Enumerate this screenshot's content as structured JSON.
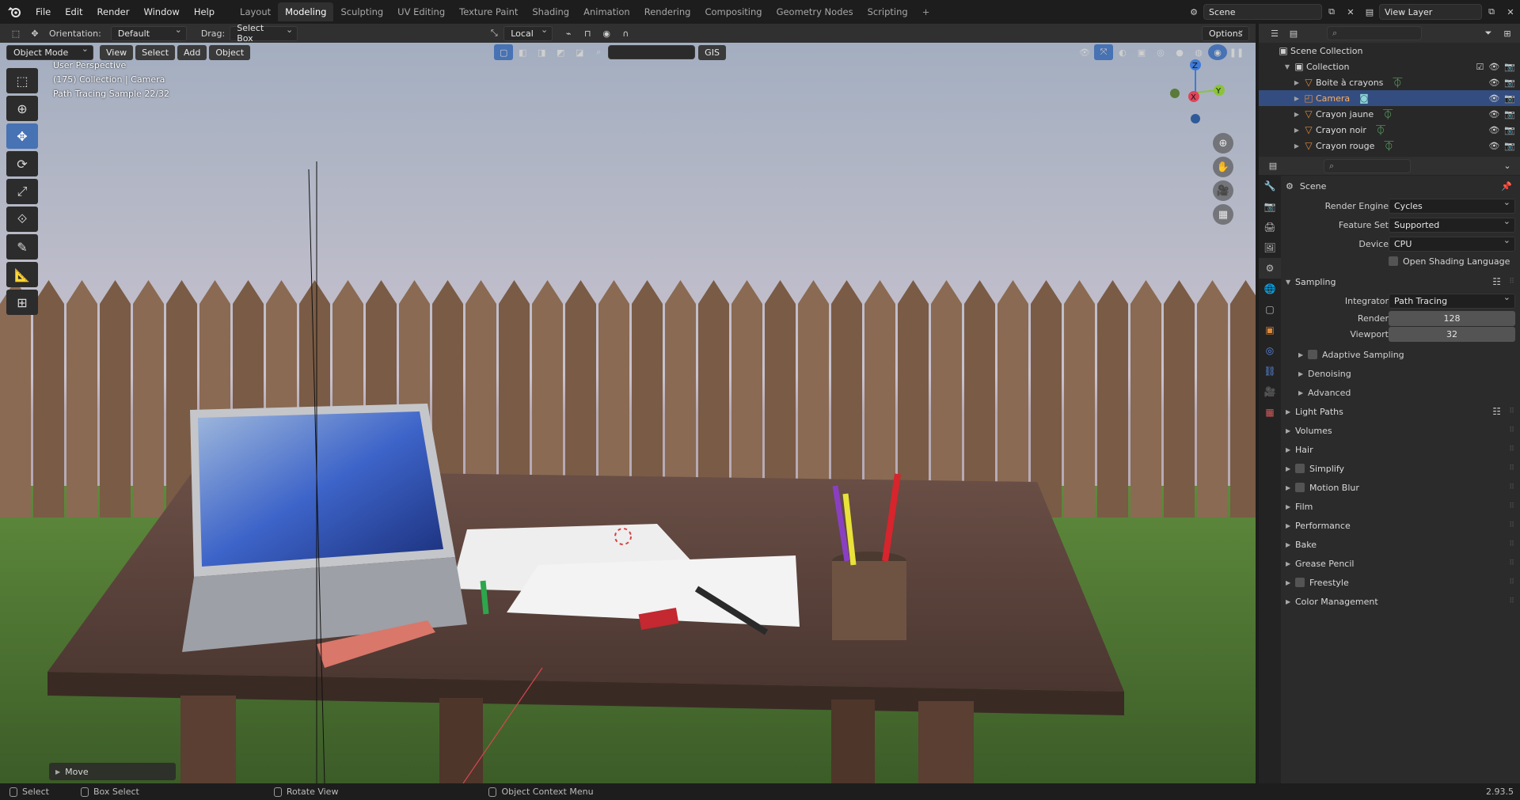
{
  "menu": [
    "File",
    "Edit",
    "Render",
    "Window",
    "Help"
  ],
  "workspace_tabs": [
    "Layout",
    "Modeling",
    "Sculpting",
    "UV Editing",
    "Texture Paint",
    "Shading",
    "Animation",
    "Rendering",
    "Compositing",
    "Geometry Nodes",
    "Scripting"
  ],
  "active_tab": "Modeling",
  "scene_name": "Scene",
  "view_layer": "View Layer",
  "header": {
    "orientation_label": "Orientation:",
    "orientation_value": "Default",
    "drag_label": "Drag:",
    "drag_value": "Select Box",
    "pivot_value": "Local",
    "options_label": "Options"
  },
  "viewport": {
    "mode": "Object Mode",
    "menu": [
      "View",
      "Select",
      "Add",
      "Object"
    ],
    "gis_label": "GIS",
    "overlay_lines": [
      "User Perspective",
      "(175) Collection | Camera",
      "Path Tracing Sample 22/32"
    ],
    "last_op": "Move",
    "gizmo_axes": {
      "x": "X",
      "y": "Y",
      "z": "Z"
    },
    "colors": {
      "x": "#e0445a",
      "y": "#8ac43a",
      "z": "#3f7ad6"
    }
  },
  "outliner": {
    "root": "Scene Collection",
    "collection": "Collection",
    "items": [
      {
        "name": "Boite à crayons",
        "selected": false
      },
      {
        "name": "Camera",
        "selected": true
      },
      {
        "name": "Crayon jaune",
        "selected": false
      },
      {
        "name": "Crayon noir",
        "selected": false
      },
      {
        "name": "Crayon rouge",
        "selected": false
      }
    ]
  },
  "properties": {
    "context": "Scene",
    "render_engine": {
      "label": "Render Engine",
      "value": "Cycles"
    },
    "feature_set": {
      "label": "Feature Set",
      "value": "Supported"
    },
    "device": {
      "label": "Device",
      "value": "CPU"
    },
    "osl": "Open Shading Language",
    "sampling": {
      "title": "Sampling",
      "integrator": {
        "label": "Integrator",
        "value": "Path Tracing"
      },
      "render": {
        "label": "Render",
        "value": "128"
      },
      "viewport": {
        "label": "Viewport",
        "value": "32"
      },
      "subs": [
        "Adaptive Sampling",
        "Denoising",
        "Advanced"
      ]
    },
    "sections": [
      {
        "name": "Light Paths",
        "checkbox": false
      },
      {
        "name": "Volumes",
        "checkbox": false
      },
      {
        "name": "Hair",
        "checkbox": false
      },
      {
        "name": "Simplify",
        "checkbox": true
      },
      {
        "name": "Motion Blur",
        "checkbox": true
      },
      {
        "name": "Film",
        "checkbox": false
      },
      {
        "name": "Performance",
        "checkbox": false
      },
      {
        "name": "Bake",
        "checkbox": false
      },
      {
        "name": "Grease Pencil",
        "checkbox": false
      },
      {
        "name": "Freestyle",
        "checkbox": true
      },
      {
        "name": "Color Management",
        "checkbox": false
      }
    ]
  },
  "status_bar": {
    "select": "Select",
    "box_select": "Box Select",
    "rotate_view": "Rotate View",
    "context_menu": "Object Context Menu",
    "version": "2.93.5"
  }
}
